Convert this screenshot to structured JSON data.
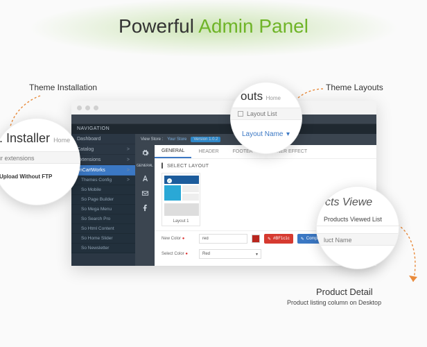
{
  "title": {
    "part1": "Powerful ",
    "part2": "Admin Panel"
  },
  "annotations": {
    "theme_installation": "Theme Installation",
    "theme_layouts": "Theme Layouts",
    "product_detail": "Product Detail",
    "product_detail_sub": "Product listing column on Desktop"
  },
  "zoom_installer": {
    "big": "Installer",
    "crumb": "Home",
    "row": "our extensions",
    "note": "Upload Without FTP"
  },
  "zoom_layouts": {
    "head": "outs",
    "crumb": "Home",
    "line": "Layout List",
    "link": "Layout Name",
    "chev": "▾"
  },
  "zoom_products": {
    "head": "cts Viewe",
    "line": "Products Viewed List",
    "row": "luct Name"
  },
  "window": {
    "nav_label": "NAVIGATION",
    "sidebar": [
      {
        "label": "Dashboard",
        "type": "top"
      },
      {
        "label": "Catalog",
        "type": "top",
        "chev": ">"
      },
      {
        "label": "Extensions",
        "type": "top",
        "chev": ">"
      },
      {
        "label": "enCartWorks",
        "type": "active",
        "chev": ">"
      },
      {
        "label": "Themes Config",
        "type": "sub",
        "chev": ">"
      },
      {
        "label": "So Mobile",
        "type": "sub"
      },
      {
        "label": "So Page Builder",
        "type": "sub"
      },
      {
        "label": "So Mega Menu",
        "type": "sub"
      },
      {
        "label": "So Search Pro",
        "type": "sub"
      },
      {
        "label": "So Html Content",
        "type": "sub"
      },
      {
        "label": "So Home Slider",
        "type": "sub"
      },
      {
        "label": "So Newsletter",
        "type": "sub"
      }
    ],
    "stripe": {
      "view": "View Store :",
      "store": "Your Store",
      "ver": "Version 1.0.2"
    },
    "iconcol_label": "GENERAL",
    "tabs": [
      "GENERAL",
      "HEADER",
      "FOOTER",
      "BANNER EFFECT"
    ],
    "section": "SELECT LAYOUT",
    "layout_caption": "Layout 1",
    "form": {
      "new_color": "New Color",
      "new_color_val": "red",
      "hex": "#BF1c1c",
      "compile": "Compile CSS",
      "select_color": "Select Color",
      "select_val": "Red"
    }
  }
}
